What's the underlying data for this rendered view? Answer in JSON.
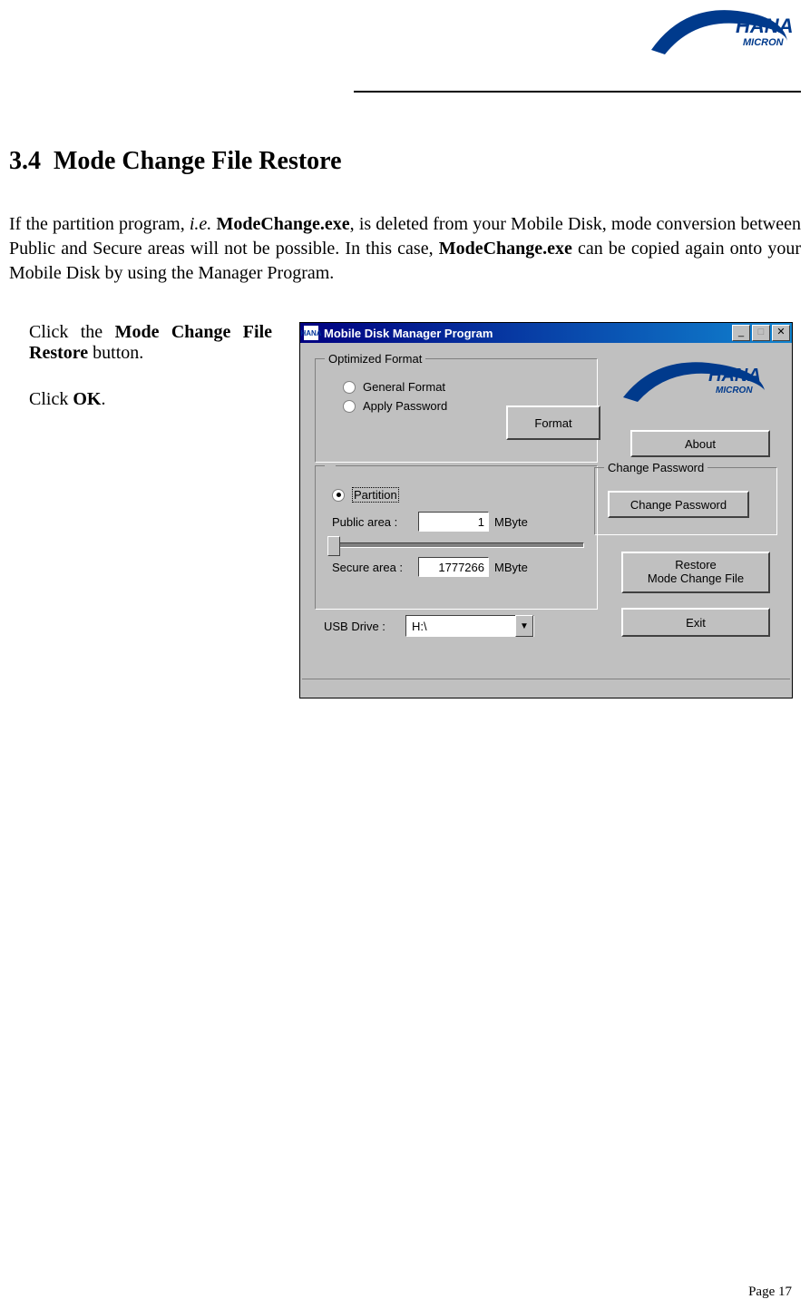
{
  "logo": {
    "brand_top": "HANA",
    "brand_bottom": "MICRON"
  },
  "section": {
    "number": "3.4",
    "title": "Mode Change File Restore"
  },
  "intro": {
    "pre": "If the partition program, ",
    "ie": "i.e.",
    "exe1": " ModeChange.exe",
    "mid": ", is deleted from your Mobile Disk, mode conversion between Public and Secure areas will not be possible.  In this case, ",
    "exe2": "ModeChange.exe",
    "post": " can be copied again onto your Mobile Disk by using the Manager Program."
  },
  "steps": [
    {
      "pre": "Click the ",
      "bold": "Mode Change File Restore",
      "post": " button."
    },
    {
      "pre": "Click ",
      "bold": "OK",
      "post": "."
    }
  ],
  "dialog": {
    "title": "Mobile Disk Manager Program",
    "icon_text": "HANA",
    "groups": {
      "optimized": "Optimized Format",
      "change_pwd": "Change Password"
    },
    "radios": {
      "general": "General Format",
      "apply_pwd": "Apply Password",
      "partition": "Partition"
    },
    "labels": {
      "public_area": "Public area :",
      "secure_area": "Secure area :",
      "mbyte": "MByte",
      "usb_drive": "USB Drive :"
    },
    "values": {
      "public": "1",
      "secure": "1777266",
      "drive": "H:\\"
    },
    "buttons": {
      "format": "Format",
      "about": "About",
      "change_pwd": "Change Password",
      "restore_l1": "Restore",
      "restore_l2": "Mode Change File",
      "exit": "Exit"
    },
    "win": {
      "min": "_",
      "max": "□",
      "close": "✕"
    }
  },
  "footer": {
    "page": "Page 17"
  }
}
